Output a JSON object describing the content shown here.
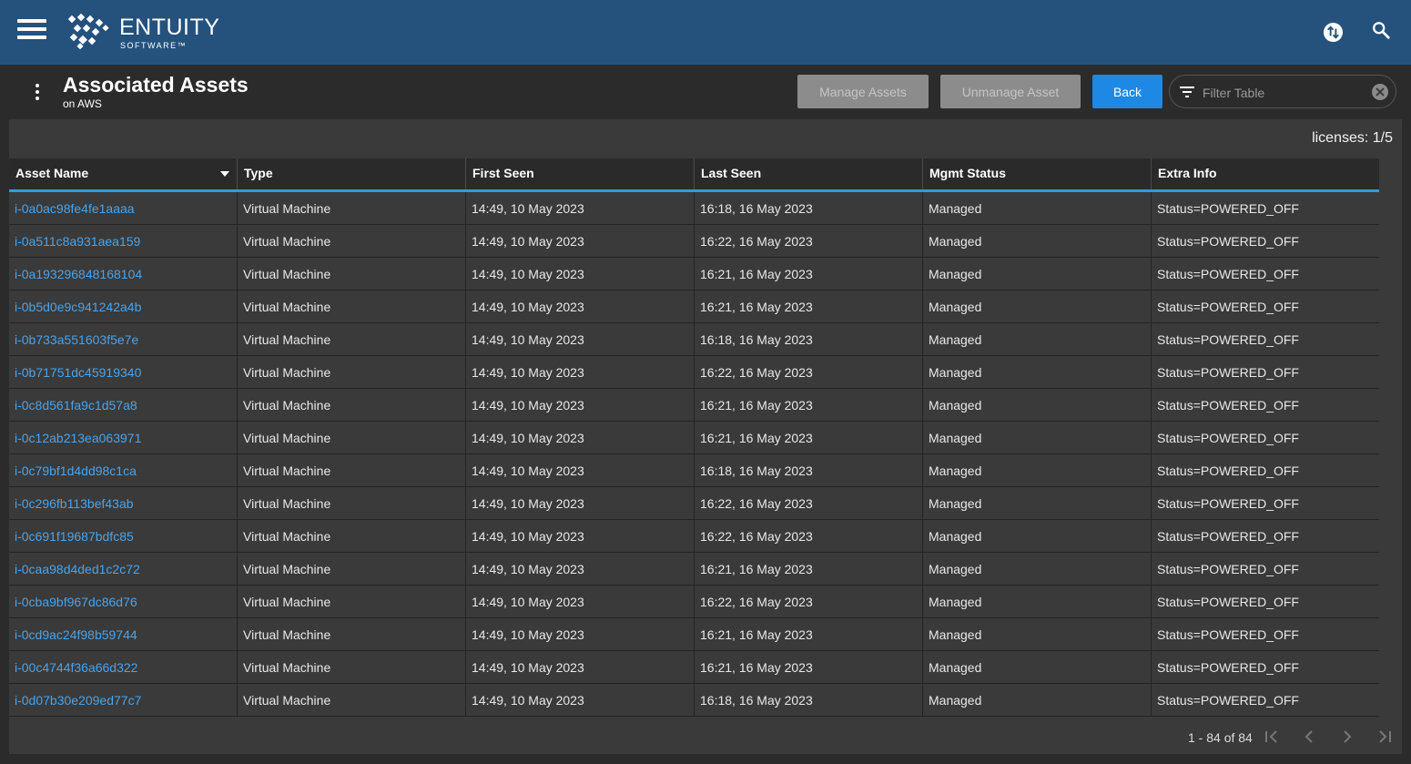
{
  "app": {
    "logo_text": "ENTUITY",
    "logo_sub": "SOFTWARE™",
    "icons": [
      "menu-icon",
      "sync-icon",
      "search-icon"
    ]
  },
  "header": {
    "title": "Associated Assets",
    "subtitle": "on AWS",
    "manage_label": "Manage Assets",
    "unmanage_label": "Unmanage Asset",
    "back_label": "Back",
    "filter_placeholder": "Filter Table"
  },
  "colors": {
    "topbar": "#24527c",
    "primary": "#1e88e5",
    "link": "#4aa3ea",
    "accent_line": "#3399e0"
  },
  "table": {
    "licenses": "licenses: 1/5",
    "columns": [
      "Asset Name",
      "Type",
      "First Seen",
      "Last Seen",
      "Mgmt Status",
      "Extra Info"
    ],
    "rows": [
      [
        "i-0a0ac98fe4fe1aaaa",
        "Virtual Machine",
        "14:49, 10 May 2023",
        "16:18, 16 May 2023",
        "Managed",
        "Status=POWERED_OFF"
      ],
      [
        "i-0a511c8a931aea159",
        "Virtual Machine",
        "14:49, 10 May 2023",
        "16:22, 16 May 2023",
        "Managed",
        "Status=POWERED_OFF"
      ],
      [
        "i-0a193296848168104",
        "Virtual Machine",
        "14:49, 10 May 2023",
        "16:21, 16 May 2023",
        "Managed",
        "Status=POWERED_OFF"
      ],
      [
        "i-0b5d0e9c941242a4b",
        "Virtual Machine",
        "14:49, 10 May 2023",
        "16:21, 16 May 2023",
        "Managed",
        "Status=POWERED_OFF"
      ],
      [
        "i-0b733a551603f5e7e",
        "Virtual Machine",
        "14:49, 10 May 2023",
        "16:18, 16 May 2023",
        "Managed",
        "Status=POWERED_OFF"
      ],
      [
        "i-0b71751dc45919340",
        "Virtual Machine",
        "14:49, 10 May 2023",
        "16:22, 16 May 2023",
        "Managed",
        "Status=POWERED_OFF"
      ],
      [
        "i-0c8d561fa9c1d57a8",
        "Virtual Machine",
        "14:49, 10 May 2023",
        "16:21, 16 May 2023",
        "Managed",
        "Status=POWERED_OFF"
      ],
      [
        "i-0c12ab213ea063971",
        "Virtual Machine",
        "14:49, 10 May 2023",
        "16:21, 16 May 2023",
        "Managed",
        "Status=POWERED_OFF"
      ],
      [
        "i-0c79bf1d4dd98c1ca",
        "Virtual Machine",
        "14:49, 10 May 2023",
        "16:18, 16 May 2023",
        "Managed",
        "Status=POWERED_OFF"
      ],
      [
        "i-0c296fb113bef43ab",
        "Virtual Machine",
        "14:49, 10 May 2023",
        "16:22, 16 May 2023",
        "Managed",
        "Status=POWERED_OFF"
      ],
      [
        "i-0c691f19687bdfc85",
        "Virtual Machine",
        "14:49, 10 May 2023",
        "16:22, 16 May 2023",
        "Managed",
        "Status=POWERED_OFF"
      ],
      [
        "i-0caa98d4ded1c2c72",
        "Virtual Machine",
        "14:49, 10 May 2023",
        "16:21, 16 May 2023",
        "Managed",
        "Status=POWERED_OFF"
      ],
      [
        "i-0cba9bf967dc86d76",
        "Virtual Machine",
        "14:49, 10 May 2023",
        "16:22, 16 May 2023",
        "Managed",
        "Status=POWERED_OFF"
      ],
      [
        "i-0cd9ac24f98b59744",
        "Virtual Machine",
        "14:49, 10 May 2023",
        "16:21, 16 May 2023",
        "Managed",
        "Status=POWERED_OFF"
      ],
      [
        "i-00c4744f36a66d322",
        "Virtual Machine",
        "14:49, 10 May 2023",
        "16:21, 16 May 2023",
        "Managed",
        "Status=POWERED_OFF"
      ],
      [
        "i-0d07b30e209ed77c7",
        "Virtual Machine",
        "14:49, 10 May 2023",
        "16:18, 16 May 2023",
        "Managed",
        "Status=POWERED_OFF"
      ]
    ]
  },
  "pager": {
    "range_text": "1 - 84 of 84"
  }
}
